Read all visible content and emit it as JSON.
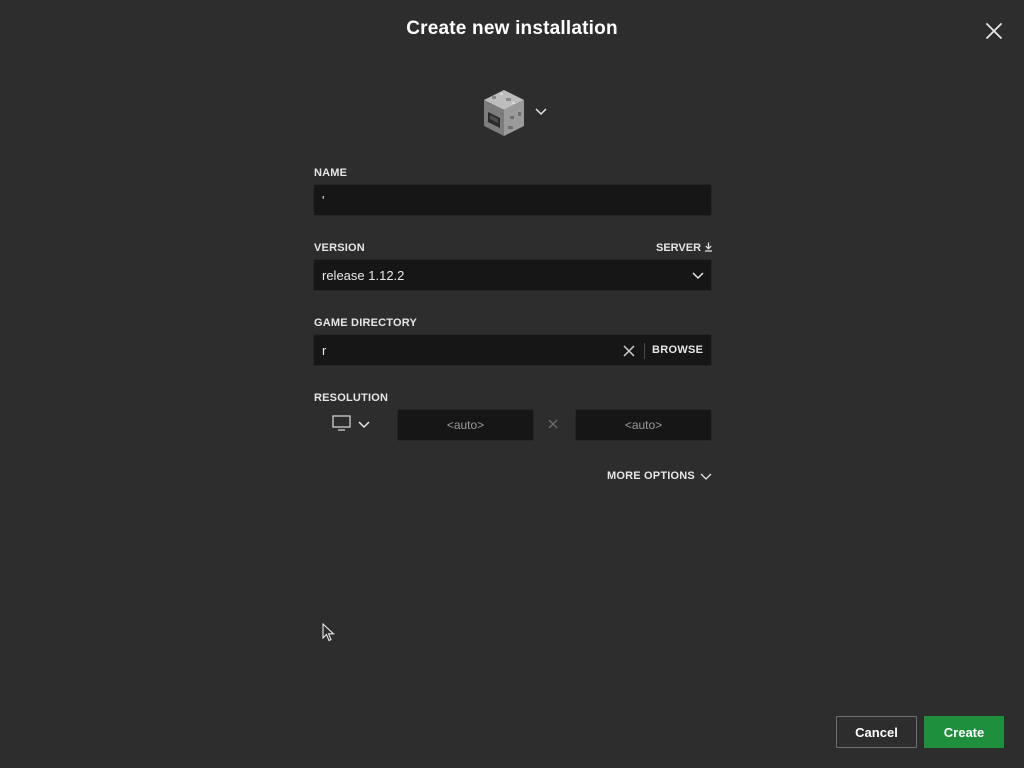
{
  "dialog": {
    "title": "Create new installation",
    "close_icon": "close-icon"
  },
  "icon_picker": {
    "icon": "furnace-block-icon",
    "dropdown_icon": "chevron-down-icon"
  },
  "name": {
    "label": "NAME",
    "value": "'"
  },
  "version": {
    "label": "VERSION",
    "server_label": "SERVER",
    "server_icon": "download-icon",
    "selected": "release 1.12.2"
  },
  "game_directory": {
    "label": "GAME DIRECTORY",
    "value": "r",
    "browse_label": "BROWSE",
    "clear_icon": "clear-icon"
  },
  "resolution": {
    "label": "RESOLUTION",
    "preset_icon": "monitor-icon",
    "width_placeholder": "<auto>",
    "height_placeholder": "<auto>",
    "separator_icon": "times-icon"
  },
  "more_options": {
    "label": "MORE OPTIONS"
  },
  "footer": {
    "cancel_label": "Cancel",
    "create_label": "Create"
  },
  "colors": {
    "background": "#2d2d2d",
    "field_background": "#161616",
    "primary_button": "#1e8f3c",
    "text": "#ffffff"
  }
}
